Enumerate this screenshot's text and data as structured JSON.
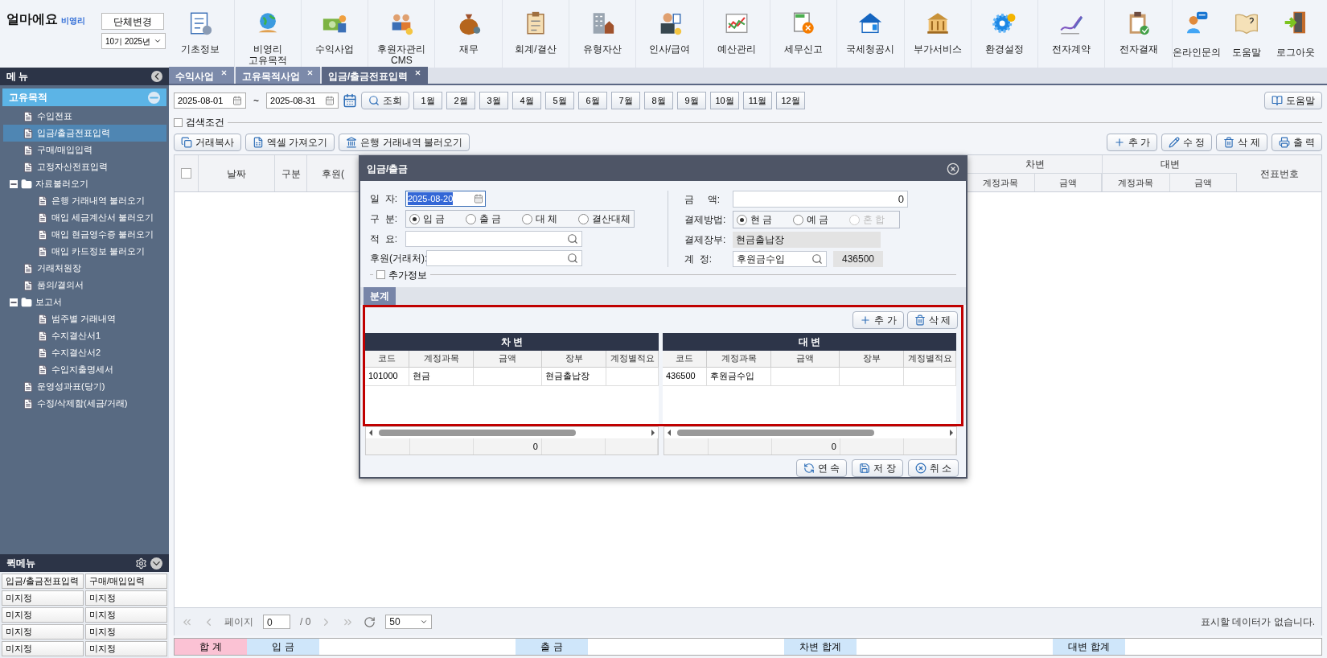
{
  "header": {
    "logo": {
      "text": "얼마에요",
      "sub": "비영리"
    },
    "org_button": "단체변경",
    "period": "10기 2025년",
    "menu_items": [
      "기초정보",
      "비영리\n고유목적",
      "수익사업",
      "후원자관리\nCMS",
      "재무",
      "회계/결산",
      "유형자산",
      "인사/급여",
      "예산관리",
      "세무신고",
      "국세청공시",
      "부가서비스",
      "환경설정",
      "전자계약",
      "전자결재"
    ],
    "right_items": [
      "온라인문의",
      "도움말",
      "로그아웃"
    ]
  },
  "sidebar": {
    "title": "메 뉴",
    "section": {
      "label": "고유목적",
      "expanded": true,
      "items": [
        {
          "kind": "page",
          "label": "수입전표",
          "selected": false
        },
        {
          "kind": "page",
          "label": "입금/출금전표입력",
          "selected": true
        },
        {
          "kind": "page",
          "label": "구매/매입입력",
          "selected": false
        },
        {
          "kind": "page",
          "label": "고정자산전표입력",
          "selected": false
        },
        {
          "kind": "folder",
          "label": "자료불러오기",
          "selected": false,
          "expanded": true,
          "children": [
            {
              "kind": "page",
              "label": "은행 거래내역 불러오기",
              "selected": false
            },
            {
              "kind": "page",
              "label": "매입 세금계산서 불러오기",
              "selected": false
            },
            {
              "kind": "page",
              "label": "매입 현금영수증 불러오기",
              "selected": false
            },
            {
              "kind": "page",
              "label": "매입 카드정보 불러오기",
              "selected": false
            }
          ]
        },
        {
          "kind": "page",
          "label": "거래처원장",
          "selected": false
        },
        {
          "kind": "page",
          "label": "품의/결의서",
          "selected": false
        },
        {
          "kind": "folder",
          "label": "보고서",
          "selected": false,
          "expanded": true,
          "children": [
            {
              "kind": "page",
              "label": "범주별 거래내역",
              "selected": false
            },
            {
              "kind": "page",
              "label": "수지결산서1",
              "selected": false
            },
            {
              "kind": "page",
              "label": "수지결산서2",
              "selected": false
            },
            {
              "kind": "page",
              "label": "수입지출명세서",
              "selected": false
            }
          ]
        },
        {
          "kind": "page",
          "label": "운영성과표(당기)",
          "selected": false
        },
        {
          "kind": "page",
          "label": "수정/삭제함(세금/거래)",
          "selected": false
        }
      ]
    }
  },
  "quick_menu": {
    "title": "퀵메뉴",
    "items": [
      "입금/출금전표입력",
      "구매/매입입력",
      "미지정",
      "미지정",
      "미지정",
      "미지정",
      "미지정",
      "미지정",
      "미지정",
      "미지정"
    ]
  },
  "tabs": [
    {
      "label": "수익사업",
      "selected": false
    },
    {
      "label": "고유목적사업",
      "selected": false
    },
    {
      "label": "입금/출금전표입력",
      "selected": true
    }
  ],
  "toolbar": {
    "date_from": "2025-08-01",
    "separator": "~",
    "date_to": "2025-08-31",
    "query_button": "조회",
    "months": [
      "1월",
      "2월",
      "3월",
      "4월",
      "5월",
      "6월",
      "7월",
      "8월",
      "9월",
      "10월",
      "11월",
      "12월"
    ],
    "help_button": "도움말"
  },
  "search_conditions": {
    "label": "검색조건",
    "checked": false
  },
  "actions_left": [
    "거래복사",
    "엑셀 가져오기",
    "은행 거래내역 불러오기"
  ],
  "actions_right": [
    "추 가",
    "수 정",
    "삭 제",
    "출 력"
  ],
  "grid": {
    "select_all_checked": false,
    "columns": [
      "날짜",
      "구분",
      "후원("
    ],
    "debit": {
      "title": "차변",
      "columns": [
        "계정과목",
        "금액"
      ]
    },
    "credit": {
      "title": "대변",
      "columns": [
        "계정과목",
        "금액"
      ]
    },
    "last_column": "전표번호"
  },
  "pager": {
    "label": "페이지",
    "page": "0",
    "total": "/ 0",
    "page_size": "50",
    "message": "표시할 데이터가 없습니다."
  },
  "totals": [
    {
      "label": "합 계",
      "kind": "title"
    },
    {
      "label": "입 금",
      "kind": "field"
    },
    {
      "label": "출 금",
      "kind": "field"
    },
    {
      "label": "차변 합계",
      "kind": "field"
    },
    {
      "label": "대변 합계",
      "kind": "field"
    }
  ],
  "dialog": {
    "title": "입금/출금",
    "date": {
      "label": "일  자:",
      "value": "2025-08-20"
    },
    "type": {
      "label": "구  분:",
      "options": [
        {
          "label": "입 금",
          "selected": true,
          "disabled": false
        },
        {
          "label": "출 금",
          "selected": false,
          "disabled": false
        },
        {
          "label": "대 체",
          "selected": false,
          "disabled": false
        },
        {
          "label": "결산대체",
          "selected": false,
          "disabled": false
        }
      ]
    },
    "memo": {
      "label": "적  요:"
    },
    "sponsor": {
      "label": "후원(거래처):"
    },
    "amount": {
      "label": "금     액:",
      "value": "0"
    },
    "payment": {
      "label": "결제방법:",
      "options": [
        {
          "label": "현 금",
          "selected": true,
          "disabled": false
        },
        {
          "label": "예 금",
          "selected": false,
          "disabled": false
        },
        {
          "label": "혼 합",
          "selected": false,
          "disabled": true
        }
      ]
    },
    "ledger": {
      "label": "결제장부:",
      "value": "현금출납장"
    },
    "account": {
      "label": "계  정:",
      "value": "후원금수입",
      "code": "436500"
    },
    "extra": {
      "label": "추가정보",
      "checked": false
    },
    "tabs": [
      {
        "label": "분계",
        "selected": true
      }
    ],
    "split_buttons": [
      "추 가",
      "삭 제"
    ],
    "grids": [
      {
        "title": "차 변",
        "columns": [
          "코드",
          "계정과목",
          "금액",
          "장부",
          "계정별적요"
        ],
        "rows": [
          [
            "101000",
            "현금",
            "",
            "현금출납장",
            ""
          ]
        ],
        "total": "0"
      },
      {
        "title": "대 변",
        "columns": [
          "코드",
          "계정과목",
          "금액",
          "장부",
          "계정별적요"
        ],
        "rows": [
          [
            "436500",
            "후원금수입",
            "",
            "",
            ""
          ]
        ],
        "total": "0"
      }
    ],
    "buttons": [
      "연 속",
      "저 장",
      "취 소"
    ]
  }
}
